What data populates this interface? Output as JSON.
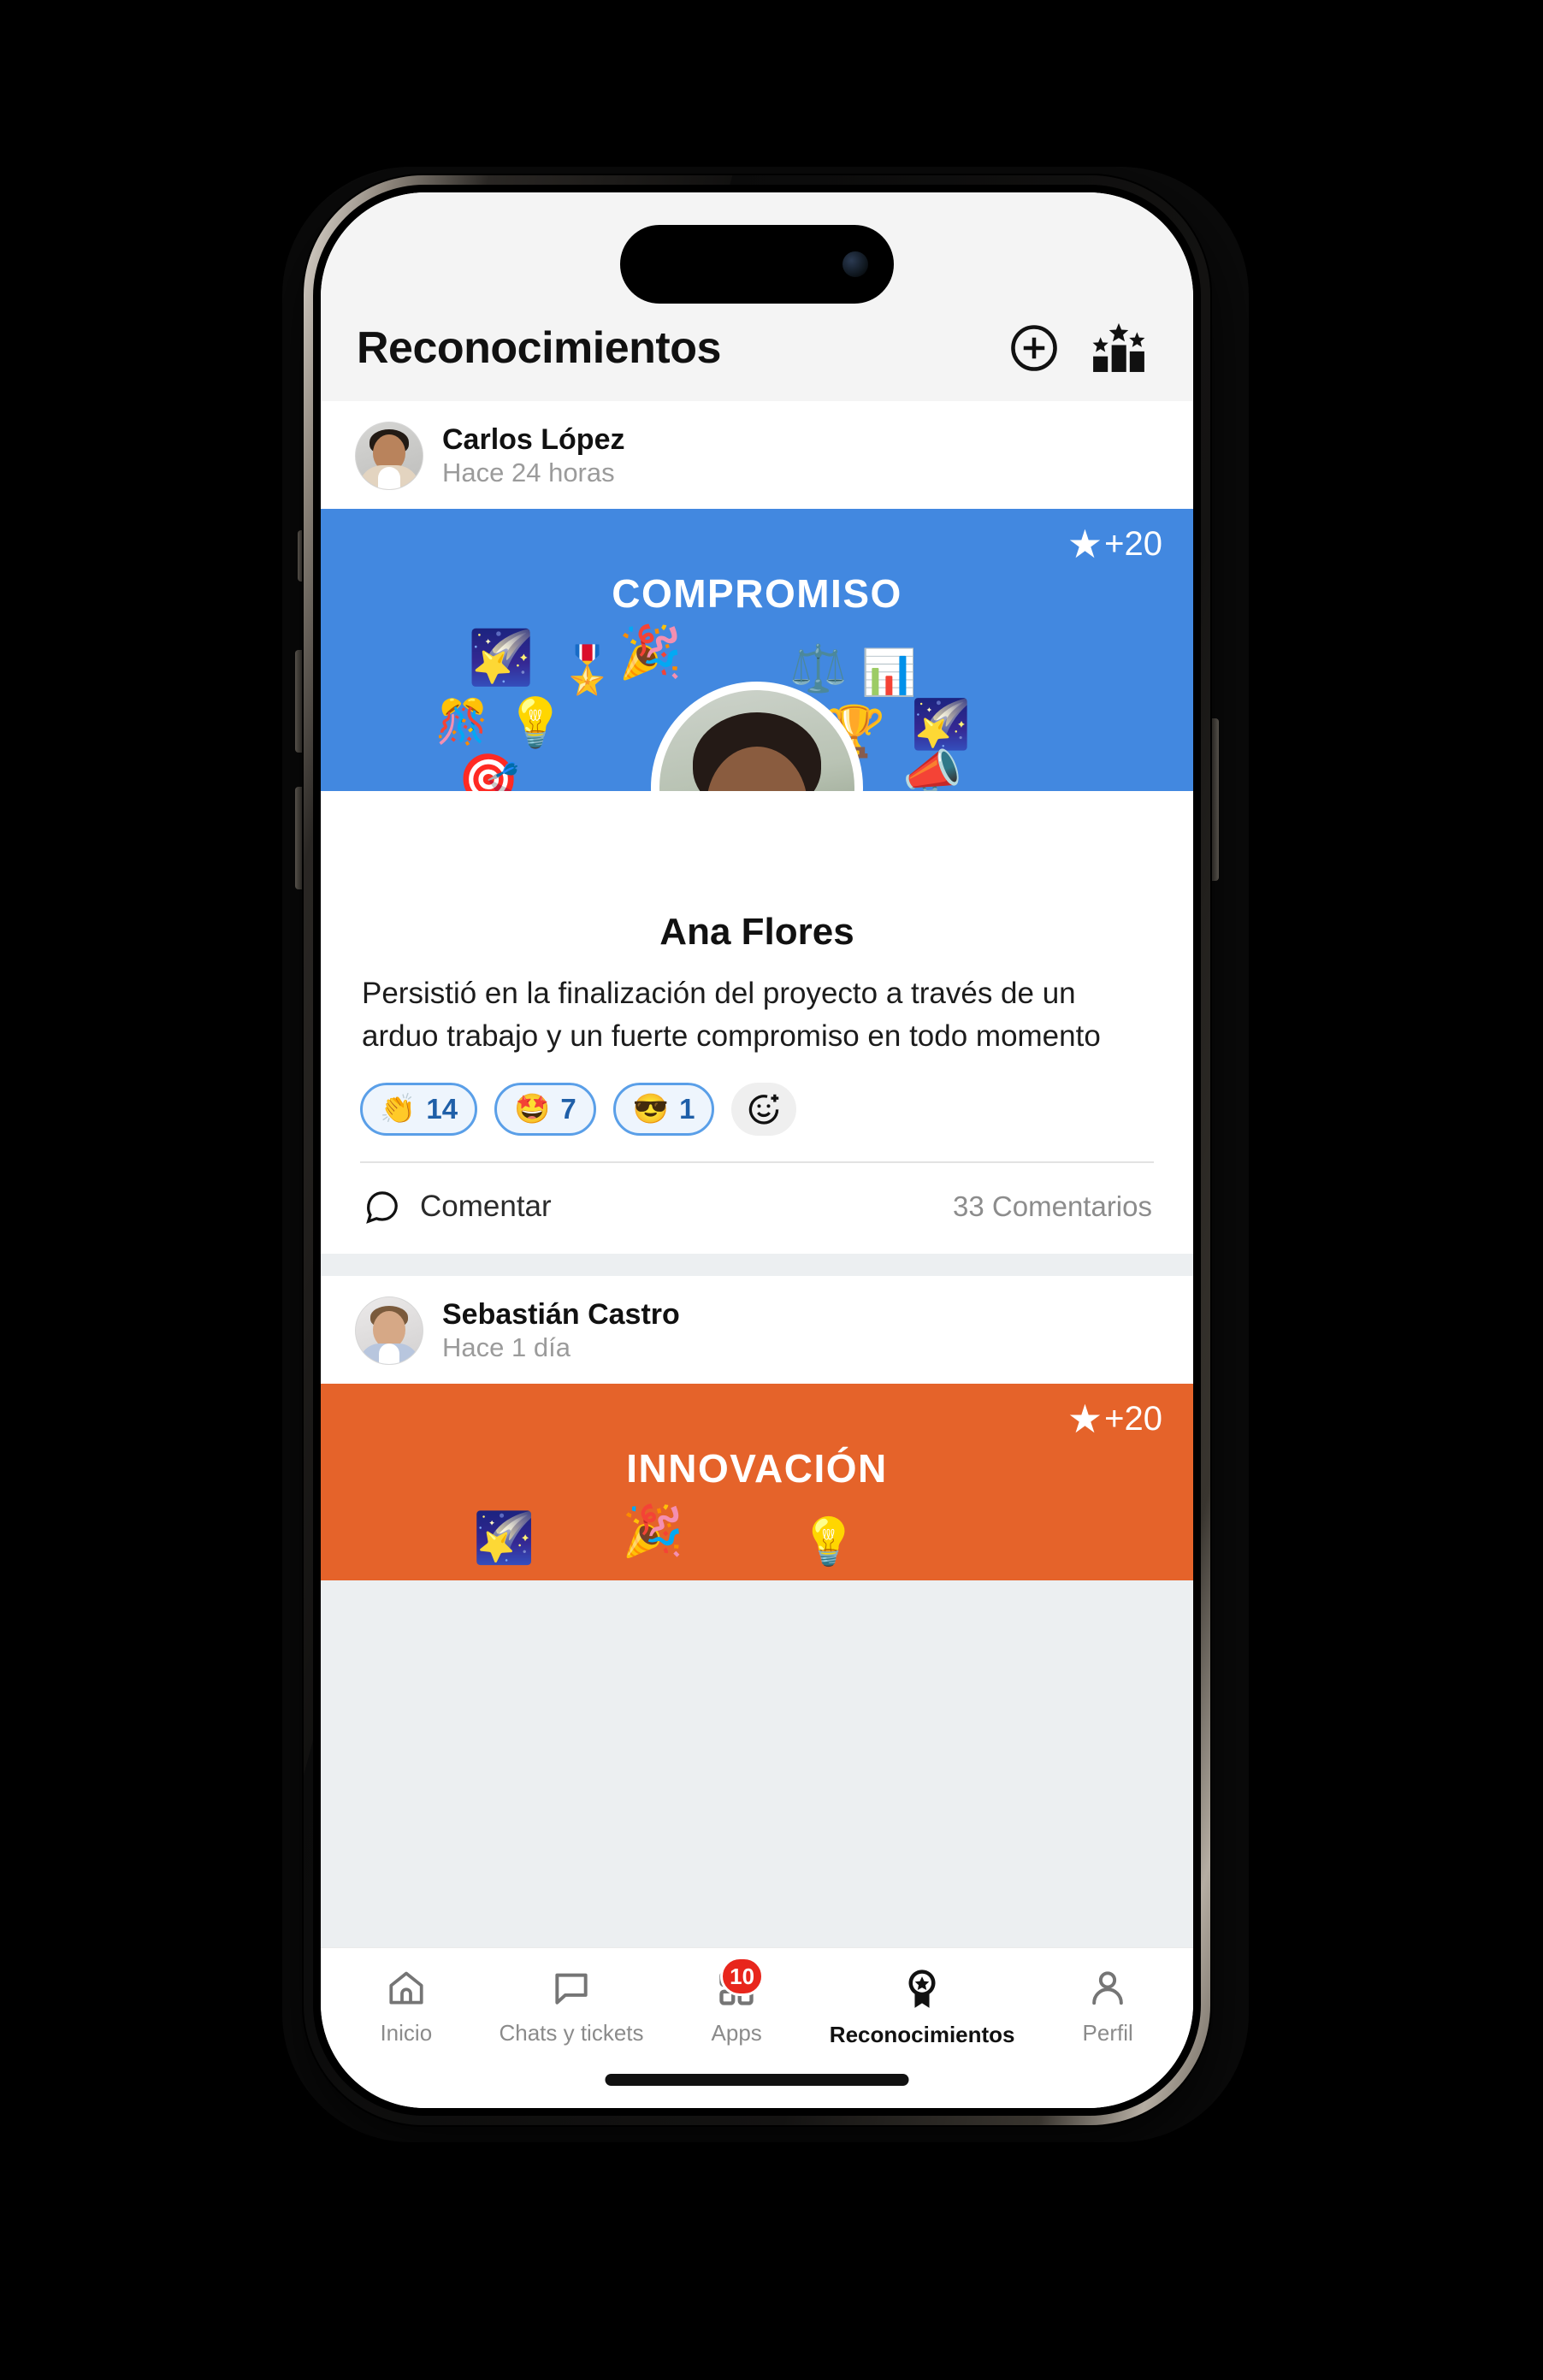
{
  "header": {
    "title": "Reconocimientos",
    "add_icon": "plus-circle-icon",
    "leaderboard_icon": "podium-stars-icon"
  },
  "posts": [
    {
      "poster_name": "Carlos López",
      "poster_time": "Hace 24 horas",
      "banner_color": "#4288E0",
      "points": "+20",
      "award_title": "COMPROMISO",
      "recipient": "Ana Flores",
      "message": "Persistió en la finalización del proyecto a través de un arduo trabajo y un fuerte compromiso en todo momento",
      "reactions": [
        {
          "emoji": "👏",
          "count": "14"
        },
        {
          "emoji": "🤩",
          "count": "7"
        },
        {
          "emoji": "😎",
          "count": "1"
        }
      ],
      "add_reaction_icon": "add-reaction-icon",
      "comment_label": "Comentar",
      "comment_icon": "comment-bubble-icon",
      "comment_count": "33 Comentarios"
    },
    {
      "poster_name": "Sebastián Castro",
      "poster_time": "Hace 1 día",
      "banner_color": "#E5632A",
      "points": "+20",
      "award_title": "INNOVACIÓN"
    }
  ],
  "decorations": [
    "🌠",
    "🎖️",
    "🎉",
    "⚖️",
    "📊",
    "💡",
    "🎊",
    "🎯",
    "🏆",
    "📣"
  ],
  "tabbar": {
    "items": [
      {
        "label": "Inicio",
        "icon": "home-icon",
        "active": false,
        "badge": ""
      },
      {
        "label": "Chats y tickets",
        "icon": "chat-icon",
        "active": false,
        "badge": ""
      },
      {
        "label": "Apps",
        "icon": "grid-apps-icon",
        "active": false,
        "badge": "10"
      },
      {
        "label": "Reconocimientos",
        "icon": "award-ribbon-icon",
        "active": true,
        "badge": ""
      },
      {
        "label": "Perfil",
        "icon": "person-icon",
        "active": false,
        "badge": ""
      }
    ]
  },
  "colors": {
    "blue": "#4288E0",
    "orange": "#E5632A",
    "badge_red": "#E8261C",
    "chip_border": "#5A9FE8"
  }
}
